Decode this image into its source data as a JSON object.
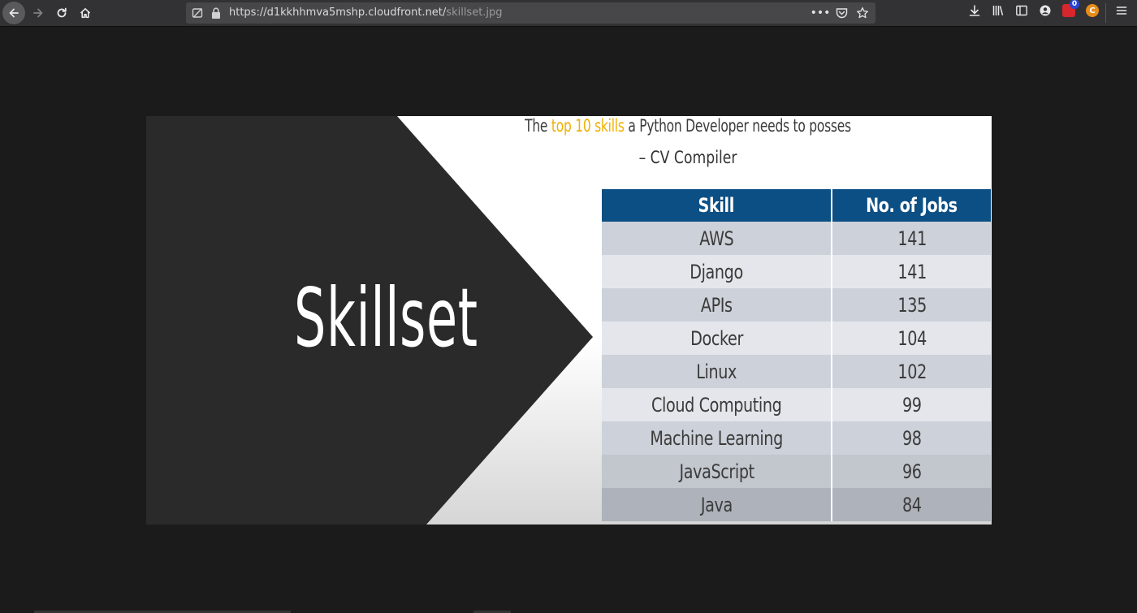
{
  "browser": {
    "url_host": "https://d1kkhhmva5mshp.cloudfront.net/",
    "url_path": "skillset.jpg",
    "extension_badge": "0",
    "extension_letter": "C"
  },
  "icons": {
    "back": "back-arrow-icon",
    "forward": "forward-arrow-icon",
    "reload": "reload-icon",
    "home": "home-icon",
    "tracking": "tracking-protection-icon",
    "lock": "lock-icon",
    "more": "more-actions-icon",
    "pocket": "pocket-icon",
    "bookmark": "bookmark-star-icon",
    "download": "download-icon",
    "library": "library-icon",
    "sidebar": "sidebar-icon",
    "account": "account-icon",
    "menu": "hamburger-menu-icon"
  },
  "slide": {
    "title_prefix": "The ",
    "title_highlight": "top 10 skills",
    "title_suffix": " a Python Developer needs to posses",
    "subtitle": "– CV Compiler",
    "big_word": "Skillset",
    "table": {
      "headers": [
        "Skill",
        "No. of Jobs"
      ],
      "rows": [
        [
          "AWS",
          "141"
        ],
        [
          "Django",
          "141"
        ],
        [
          "APIs",
          "135"
        ],
        [
          "Docker",
          "104"
        ],
        [
          "Linux",
          "102"
        ],
        [
          "Cloud Computing",
          "99"
        ],
        [
          "Machine Learning",
          "98"
        ],
        [
          "JavaScript",
          "96"
        ],
        [
          "Java",
          "84"
        ]
      ]
    }
  },
  "colors": {
    "page_bg": "#1c1b1b",
    "header_blue": "#0c4f84",
    "highlight_gold": "#f0b000",
    "arrow_dark": "#2a2a2a"
  }
}
